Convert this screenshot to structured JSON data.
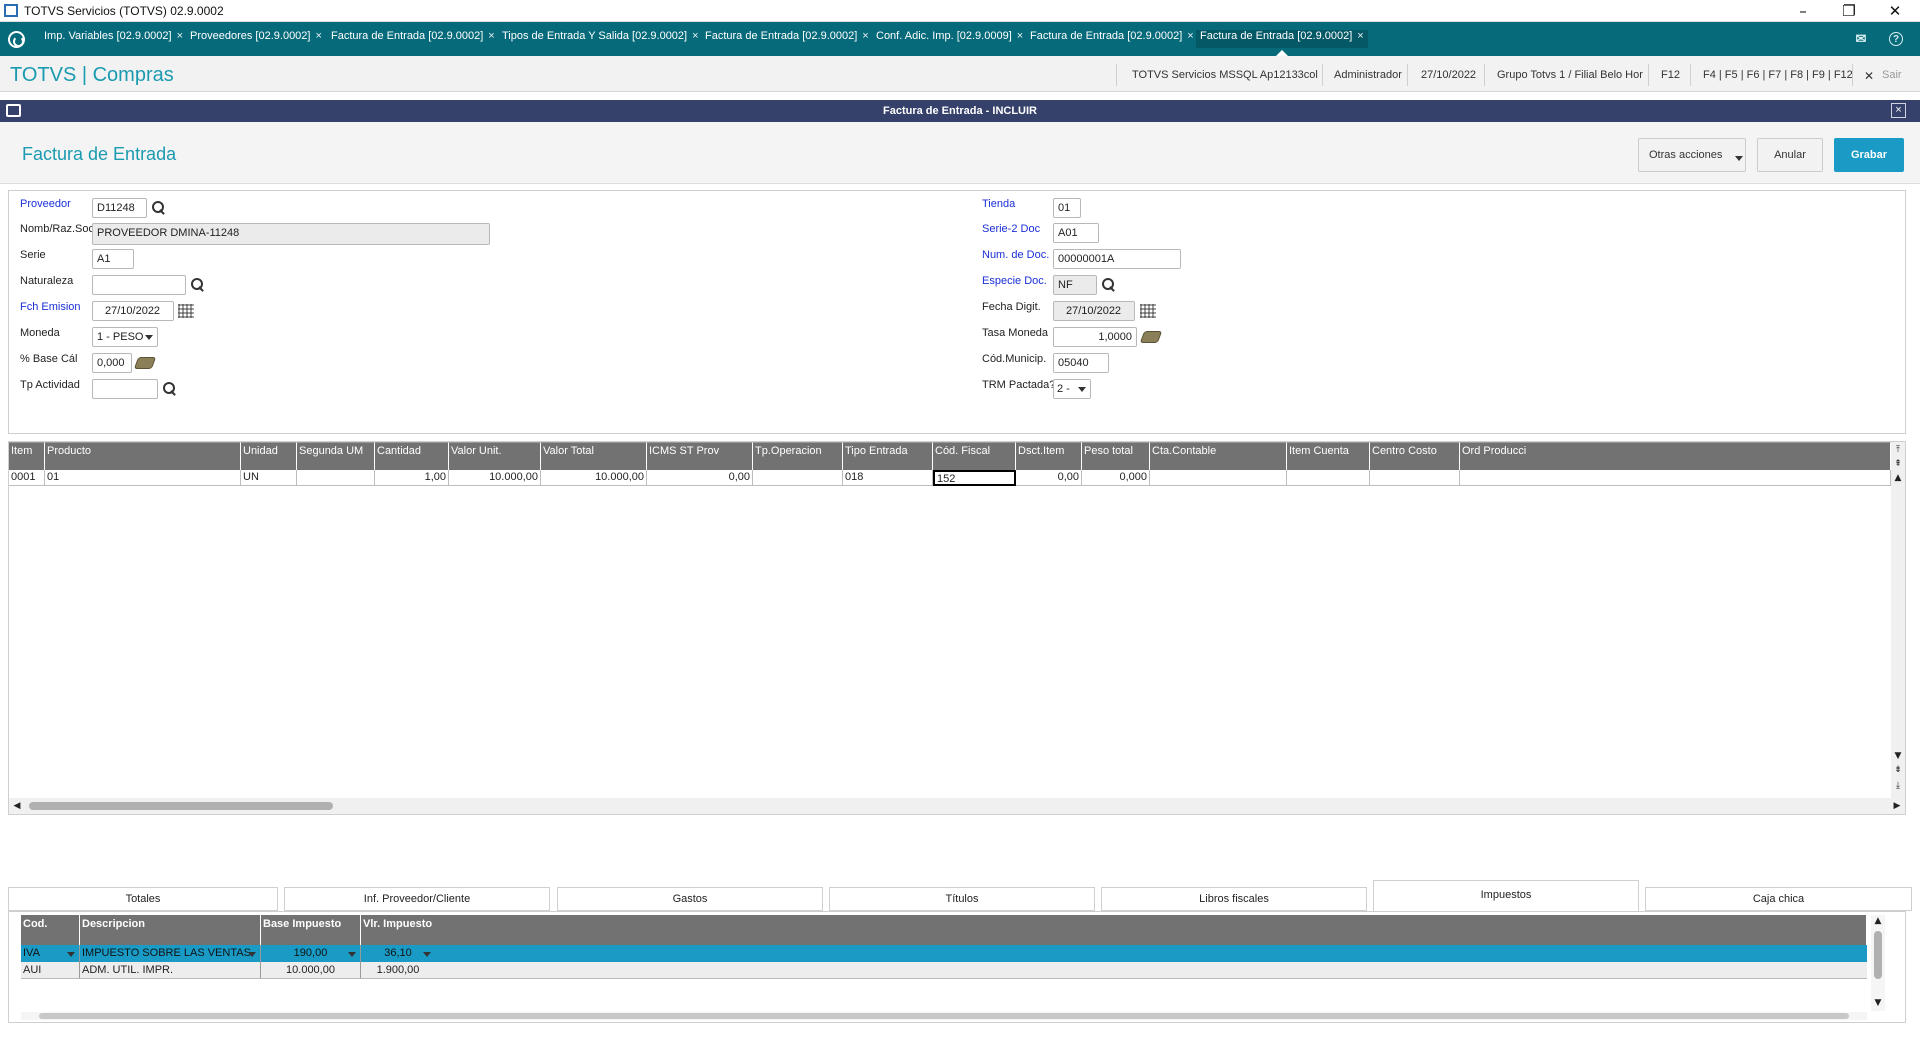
{
  "window": {
    "title": "TOTVS Servicios (TOTVS) 02.9.0002",
    "minimize": "–",
    "restore": "❐",
    "close": "✕"
  },
  "tabs": [
    {
      "label": "Imp. Variables [02.9.0002]"
    },
    {
      "label": "Proveedores [02.9.0002]"
    },
    {
      "label": "Factura de Entrada [02.9.0002]"
    },
    {
      "label": "Tipos de Entrada Y Salida [02.9.0002]"
    },
    {
      "label": "Factura de Entrada [02.9.0002]"
    },
    {
      "label": "Conf. Adic. Imp. [02.9.0009]"
    },
    {
      "label": "Factura de Entrada [02.9.0002]"
    },
    {
      "label": "Factura de Entrada [02.9.0002]"
    }
  ],
  "tab_close": "×",
  "tabbar_icons": {
    "mail": "✉",
    "help": "?"
  },
  "brand": {
    "name": "TOTVS | Compras"
  },
  "brand_info": {
    "environment": "TOTVS Servicios MSSQL Ap12133col",
    "user": "Administrador",
    "date": "27/10/2022",
    "branch": "Grupo Totvs 1 / Filial Belo Hor",
    "f12": "F12",
    "fkeys": "F4 | F5 | F6 | F7 | F8 | F9 | F12",
    "exit": "Sair",
    "exit_icon": "✕"
  },
  "dialog": {
    "title": "Factura de Entrada - INCLUIR",
    "close": "×",
    "page_title": "Factura de Entrada",
    "buttons": {
      "other": "Otras acciones",
      "cancel": "Anular",
      "save": "Grabar"
    }
  },
  "form": {
    "proveedor": {
      "label": "Proveedor",
      "value": "D11248"
    },
    "nomb": {
      "label": "Nomb/Raz.Soc",
      "value": "PROVEEDOR DMINA-11248"
    },
    "serie": {
      "label": "Serie",
      "value": "A1"
    },
    "naturaleza": {
      "label": "Naturaleza",
      "value": ""
    },
    "fch_emision": {
      "label": "Fch Emision",
      "value": "27/10/2022"
    },
    "moneda": {
      "label": "Moneda",
      "value": "1 - PESO"
    },
    "base_cal": {
      "label": "% Base Cál",
      "value": "0,000"
    },
    "tp_actividad": {
      "label": "Tp Actividad",
      "value": ""
    },
    "tienda": {
      "label": "Tienda",
      "value": "01"
    },
    "serie2": {
      "label": "Serie-2 Doc",
      "value": "A01"
    },
    "num_doc": {
      "label": "Num. de Doc.",
      "value": "00000001A"
    },
    "especie": {
      "label": "Especie Doc.",
      "value": "NF"
    },
    "fecha_digit": {
      "label": "Fecha Digit.",
      "value": "27/10/2022"
    },
    "tasa": {
      "label": "Tasa Moneda",
      "value": "1,0000"
    },
    "cod_municip": {
      "label": "Cód.Municip.",
      "value": "05040"
    },
    "trm": {
      "label": "TRM Pactada?",
      "value": "2 -"
    }
  },
  "grid": {
    "headers": [
      "Item",
      "Producto",
      "Unidad",
      "Segunda UM",
      "Cantidad",
      "Valor Unit.",
      "Valor Total",
      "ICMS ST Prov",
      "Tp.Operacion",
      "Tipo Entrada",
      "Cód. Fiscal",
      "Dsct.Item",
      "Peso total",
      "Cta.Contable",
      "Item Cuenta",
      "Centro Costo",
      "Ord Producci"
    ],
    "row": [
      "0001",
      "01",
      "UN",
      "",
      "1,00",
      "10.000,00",
      "10.000,00",
      "0,00",
      "",
      "018",
      "152",
      "0,00",
      "0,000",
      "",
      "",
      "",
      ""
    ]
  },
  "bottom_tabs": [
    "Totales",
    "Inf. Proveedor/Cliente",
    "Gastos",
    "Títulos",
    "Libros fiscales",
    "Impuestos",
    "Caja chica"
  ],
  "tax_table": {
    "headers": [
      "Cod.",
      "Descripcion",
      "Base Impuesto",
      "Vlr. Impuesto"
    ],
    "rows": [
      [
        "IVA",
        "IMPUESTO SOBRE LAS VENTAS",
        "190,00",
        "36,10"
      ],
      [
        "AUI",
        "ADM. UTIL. IMPR.",
        "10.000,00",
        "1.900,00"
      ]
    ]
  },
  "scroll": {
    "top": "⤒",
    "pgup": "⇞",
    "up": "▲",
    "down": "▼",
    "pgdn": "⇟",
    "bottom": "⤓",
    "left": "◀",
    "right": "▶"
  }
}
